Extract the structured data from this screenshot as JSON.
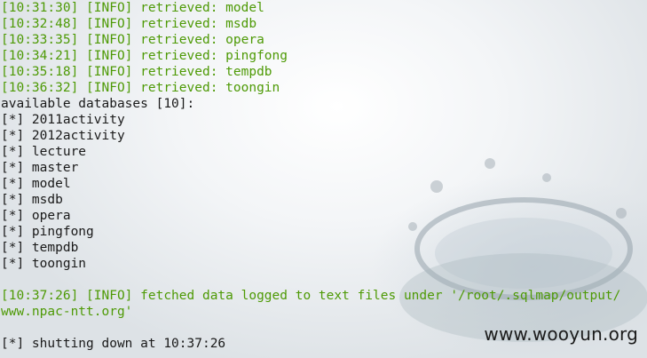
{
  "log_lines": [
    "[10:31:30] [INFO] retrieved: model",
    "[10:32:48] [INFO] retrieved: msdb",
    "[10:33:35] [INFO] retrieved: opera",
    "[10:34:21] [INFO] retrieved: pingfong",
    "[10:35:18] [INFO] retrieved: tempdb",
    "[10:36:32] [INFO] retrieved: toongin"
  ],
  "db_header": "available databases [10]:",
  "databases": [
    "[*] 2011activity",
    "[*] 2012activity",
    "[*] lecture",
    "[*] master",
    "[*] model",
    "[*] msdb",
    "[*] opera",
    "[*] pingfong",
    "[*] tempdb",
    "[*] toongin"
  ],
  "fetched_line_1": "[10:37:26] [INFO] fetched data logged to text files under '/root/.sqlmap/output/",
  "fetched_line_2": "www.npac-ntt.org'",
  "shutdown_line": "[*] shutting down at 10:37:26",
  "watermark": "www.wooyun.org",
  "colors": {
    "info_text": "#4e9a06",
    "plain_text": "#1a1a1a"
  }
}
